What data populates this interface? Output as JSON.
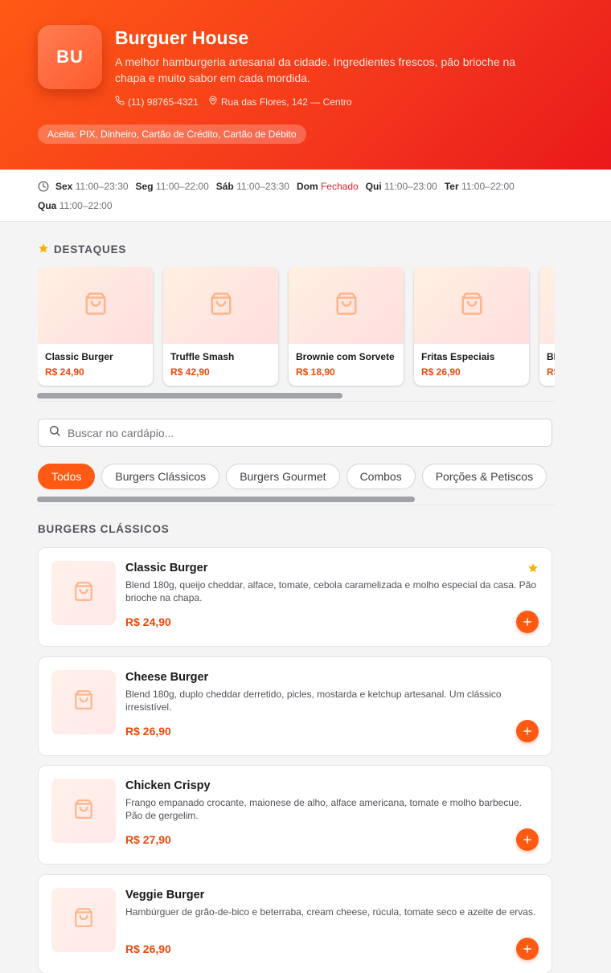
{
  "restaurant": {
    "logo_initials": "BU",
    "name": "Burguer House",
    "description": "A melhor hamburgeria artesanal da cidade. Ingredientes frescos, pão brioche na chapa e muito sabor em cada mordida.",
    "phone": "(11) 98765-4321",
    "address": "Rua das Flores, 142 — Centro",
    "payment": "Aceita: PIX, Dinheiro, Cartão de Crédito, Cartão de Débito"
  },
  "hours": [
    {
      "day": "Sex",
      "time": "11:00–23:30",
      "closed": false
    },
    {
      "day": "Seg",
      "time": "11:00–22:00",
      "closed": false
    },
    {
      "day": "Sáb",
      "time": "11:00–23:30",
      "closed": false
    },
    {
      "day": "Dom",
      "time": "Fechado",
      "closed": true
    },
    {
      "day": "Qui",
      "time": "11:00–23:00",
      "closed": false
    },
    {
      "day": "Ter",
      "time": "11:00–22:00",
      "closed": false
    },
    {
      "day": "Qua",
      "time": "11:00–22:00",
      "closed": false
    }
  ],
  "featured": {
    "label": "DESTAQUES",
    "items": [
      {
        "name": "Classic Burger",
        "price": "R$ 24,90"
      },
      {
        "name": "Truffle Smash",
        "price": "R$ 42,90"
      },
      {
        "name": "Brownie com Sorvete",
        "price": "R$ 18,90"
      },
      {
        "name": "Fritas Especiais",
        "price": "R$ 26,90"
      },
      {
        "name": "BBQ",
        "price": "R$"
      }
    ]
  },
  "search": {
    "placeholder": "Buscar no cardápio..."
  },
  "categories": [
    {
      "label": "Todos",
      "active": true
    },
    {
      "label": "Burgers Clássicos",
      "active": false
    },
    {
      "label": "Burgers Gourmet",
      "active": false
    },
    {
      "label": "Combos",
      "active": false
    },
    {
      "label": "Porções & Petiscos",
      "active": false
    }
  ],
  "menu_section": {
    "title": "BURGERS CLÁSSICOS",
    "items": [
      {
        "name": "Classic Burger",
        "description": "Blend 180g, queijo cheddar, alface, tomate, cebola caramelizada e molho especial da casa. Pão brioche na chapa.",
        "price": "R$ 24,90",
        "featured": true
      },
      {
        "name": "Cheese Burger",
        "description": "Blend 180g, duplo cheddar derretido, picles, mostarda e ketchup artesanal. Um clássico irresistível.",
        "price": "R$ 26,90",
        "featured": false
      },
      {
        "name": "Chicken Crispy",
        "description": "Frango empanado crocante, maionese de alho, alface americana, tomate e molho barbecue. Pão de gergelim.",
        "price": "R$ 27,90",
        "featured": false
      },
      {
        "name": "Veggie Burger",
        "description": "Hambúrguer de grão-de-bico e beterraba, cream cheese, rúcula, tomate seco e azeite de ervas.",
        "price": "R$ 26,90",
        "featured": false
      }
    ]
  },
  "icons": {
    "phone": "phone-icon",
    "location": "map-pin-icon",
    "clock": "clock-icon",
    "star": "star-icon",
    "bag": "shopping-bag-icon",
    "search": "search-icon",
    "add": "plus-icon"
  },
  "colors": {
    "accent": "#ff5a14",
    "price": "#ea4a0c",
    "closed": "#e11d2e",
    "star": "#f5b301"
  }
}
